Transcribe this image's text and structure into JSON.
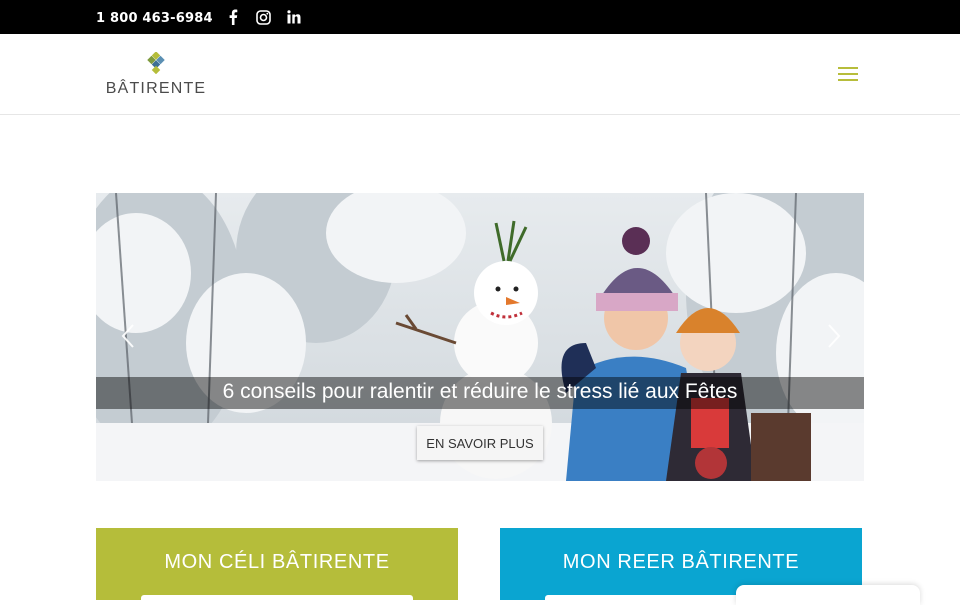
{
  "topbar": {
    "phone": "1 800 463-6984",
    "social_icons": [
      "facebook-icon",
      "instagram-icon",
      "linkedin-icon"
    ],
    "background": "#000000"
  },
  "header": {
    "logo_text": "BÂTIRENTE",
    "menu_icon": "hamburger-menu-icon",
    "accent_color": "#b7bd3b"
  },
  "slider": {
    "caption": "6 conseils pour ralentir et réduire le stress lié aux Fêtes",
    "cta_label": "EN SAVOIR PLUS",
    "prev_icon": "chevron-left-icon",
    "next_icon": "chevron-right-icon"
  },
  "cards": [
    {
      "title": "MON CÉLI BÂTIRENTE",
      "color": "#b5bd3a"
    },
    {
      "title": "MON REER BÂTIRENTE",
      "color": "#0aa5d1"
    }
  ]
}
